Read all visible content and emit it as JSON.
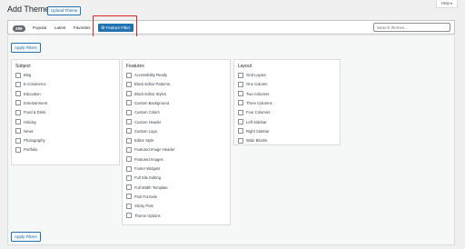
{
  "header": {
    "title": "Add Themes",
    "upload_label": "Upload Theme",
    "help_label": "Help"
  },
  "filter_bar": {
    "count": "299",
    "tabs": [
      "Popular",
      "Latest",
      "Favorites"
    ],
    "feature_filter_label": "Feature Filter",
    "search_placeholder": "Search themes..."
  },
  "apply_label": "Apply Filters",
  "filters": {
    "subject": {
      "title": "Subject",
      "options": [
        "Blog",
        "E-Commerce",
        "Education",
        "Entertainment",
        "Food & Drink",
        "Holiday",
        "News",
        "Photography",
        "Portfolio"
      ]
    },
    "features": {
      "title": "Features",
      "options": [
        "Accessibility Ready",
        "Block Editor Patterns",
        "Block Editor Styles",
        "Custom Background",
        "Custom Colors",
        "Custom Header",
        "Custom Logo",
        "Editor Style",
        "Featured Image Header",
        "Featured Images",
        "Footer Widgets",
        "Full Site Editing",
        "Full Width Template",
        "Post Formats",
        "Sticky Post",
        "Theme Options"
      ]
    },
    "layout": {
      "title": "Layout",
      "options": [
        "Grid Layout",
        "One Column",
        "Two Columns",
        "Three Columns",
        "Four Columns",
        "Left Sidebar",
        "Right Sidebar",
        "Wide Blocks"
      ]
    }
  },
  "colors": {
    "accent": "#2271b1",
    "highlight": "#e02424"
  }
}
